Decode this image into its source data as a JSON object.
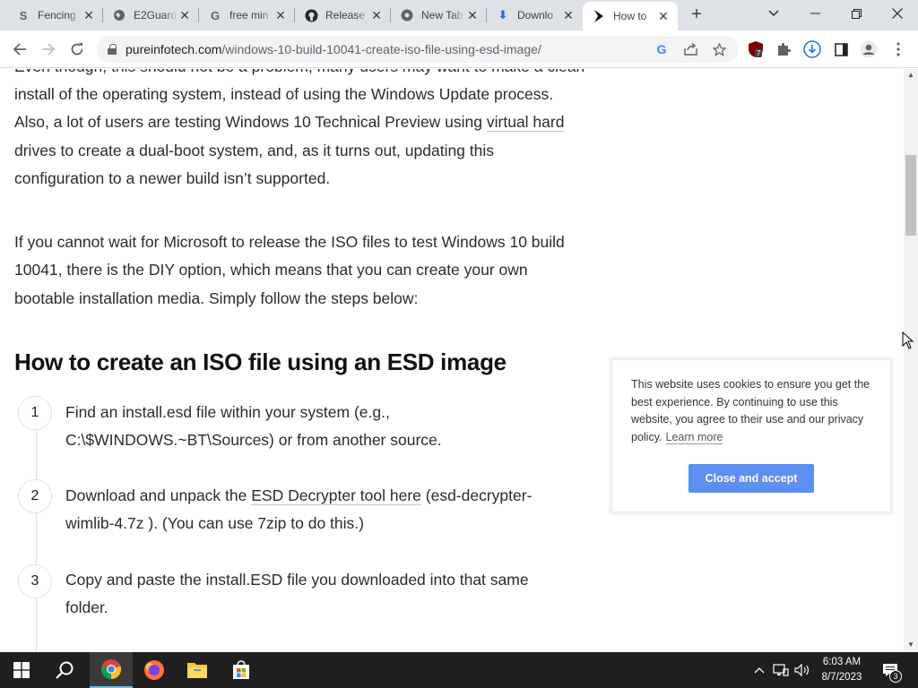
{
  "browser": {
    "tabs": [
      {
        "title": "Fencing",
        "icon": "stripe-s-icon"
      },
      {
        "title": "E2Guard",
        "icon": "globe-icon"
      },
      {
        "title": "free min",
        "icon": "google-g-icon"
      },
      {
        "title": "Release",
        "icon": "github-icon"
      },
      {
        "title": "New Tab",
        "icon": "chrome-icon"
      },
      {
        "title": "Downlo",
        "icon": "download-icon"
      },
      {
        "title": "How to",
        "icon": "pureinfotech-icon",
        "active": true
      }
    ],
    "new_tab_label": "+",
    "address": {
      "domain": "pureinfotech.com",
      "path": "/windows-10-build-10041-create-iso-file-using-esd-image/"
    },
    "extension_badge": "7"
  },
  "article": {
    "intro_top": "Even though, this should not be a problem, many users may want to make a clean",
    "para1_lines": [
      "install of the operating system, instead of using the Windows Update process.",
      "Also, a lot of users are testing Windows 10 Technical Preview using ",
      "drives to create a dual-boot system, and, as it turns out, updating this",
      "configuration to a newer build isn’t supported."
    ],
    "para1_link": "virtual hard",
    "para2_lines": [
      "If you cannot wait for Microsoft to release the ISO files to test Windows 10 build",
      "10041, there is the DIY option, which means that you can create your own",
      "bootable installation media. Simply follow the steps below:"
    ],
    "heading": "How to create an ISO file using an ESD image",
    "steps": [
      {
        "num": "1",
        "line1": "Find an install.esd file within your system (e.g.,",
        "line2": "C:\\$WINDOWS.~BT\\Sources) or from another source."
      },
      {
        "num": "2",
        "line1a": "Download and unpack the ",
        "link": "ESD Decrypter tool here",
        "line1b": " (esd-decrypter-",
        "line2": "wimlib-4.7z ). (You can use 7zip to do this.)"
      },
      {
        "num": "3",
        "line1": "Copy and paste the install.ESD file you downloaded into that same",
        "line2": "folder."
      }
    ]
  },
  "cookie_banner": {
    "text": "This website uses cookies to ensure you get the best experience. By continuing to use this website, you agree to their use and our privacy policy.",
    "learn_more": "Learn more",
    "button": "Close and accept"
  },
  "taskbar": {
    "time": "6:03 AM",
    "date": "8/7/2023",
    "notification_count": "3"
  },
  "colors": {
    "accent_button": "#5b8ff0",
    "taskbar_bg": "#1f1f1f",
    "tabstrip_bg": "#dee1e6"
  }
}
